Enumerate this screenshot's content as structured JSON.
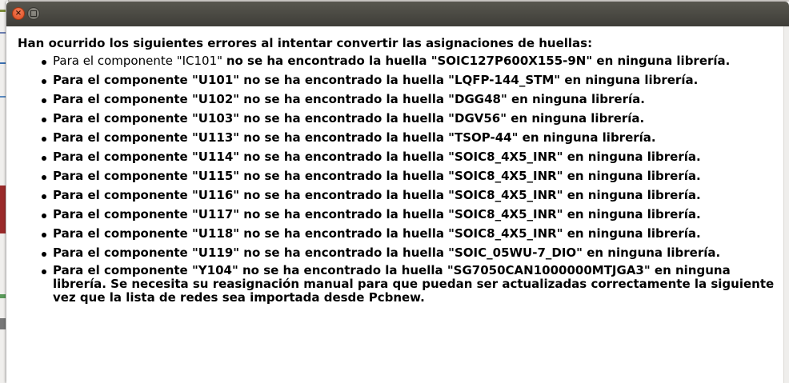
{
  "window": {
    "close_glyph": "×"
  },
  "message": {
    "heading": "Han ocurrido los siguientes errores al intentar convertir las asignaciones de huellas:",
    "first_item": {
      "prefix": "Para el componente \"IC101\" ",
      "emphasis": "no se ha encontrado la huella \"SOIC127P600X155-9N\" en ninguna librería."
    },
    "items": [
      "Para el componente \"U101\" no se ha encontrado la huella \"LQFP-144_STM\" en ninguna librería.",
      "Para el componente \"U102\" no se ha encontrado la huella \"DGG48\" en ninguna librería.",
      "Para el componente \"U103\" no se ha encontrado la huella \"DGV56\" en ninguna librería.",
      "Para el componente \"U113\" no se ha encontrado la huella \"TSOP-44\" en ninguna librería.",
      "Para el componente \"U114\" no se ha encontrado la huella \"SOIC8_4X5_INR\" en ninguna librería.",
      "Para el componente \"U115\" no se ha encontrado la huella \"SOIC8_4X5_INR\" en ninguna librería.",
      "Para el componente \"U116\" no se ha encontrado la huella \"SOIC8_4X5_INR\" en ninguna librería.",
      "Para el componente \"U117\" no se ha encontrado la huella \"SOIC8_4X5_INR\" en ninguna librería.",
      "Para el componente \"U118\" no se ha encontrado la huella \"SOIC8_4X5_INR\" en ninguna librería.",
      "Para el componente \"U119\" no se ha encontrado la huella \"SOIC_05WU-7_DIO\" en ninguna librería.",
      "Para el componente \"Y104\" no se ha encontrado la huella \"SG7050CAN1000000MTJGA3\" en ninguna librería. Se necesita su reasignación manual para que puedan ser actualizadas correctamente la siguiente vez que la lista de redes sea importada desde Pcbnew."
    ]
  },
  "colors": {
    "titlebar": "#3e3d38",
    "close_button": "#de4a1e",
    "background": "#ffffff"
  }
}
